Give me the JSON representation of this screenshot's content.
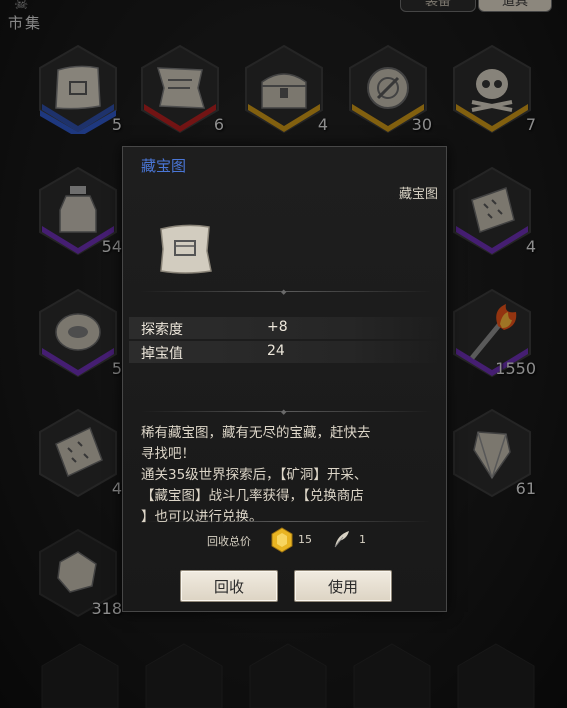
{
  "top": {
    "label": "市集",
    "tabs": [
      {
        "label": "装备",
        "active": false
      },
      {
        "label": "道具",
        "active": true
      }
    ]
  },
  "inventory": [
    {
      "name": "treasure-map",
      "count": "5",
      "rarity": "blue",
      "icon": "map-icon"
    },
    {
      "name": "scroll",
      "count": "6",
      "rarity": "red",
      "icon": "scroll-icon"
    },
    {
      "name": "treasure-chest",
      "count": "4",
      "rarity": "gold",
      "icon": "chest-icon"
    },
    {
      "name": "compass-emblem",
      "count": "30",
      "rarity": "gold",
      "icon": "emblem-icon"
    },
    {
      "name": "skull",
      "count": "7",
      "rarity": "gold",
      "icon": "skull-icon"
    },
    {
      "name": "potion-bottle",
      "count": "54",
      "rarity": "purple",
      "icon": "bottle-icon"
    },
    {
      "name": "rune-stone",
      "count": "4",
      "rarity": "purple",
      "icon": "rune-stone-icon"
    },
    {
      "name": "eye-amulet",
      "count": "5",
      "rarity": "purple",
      "icon": "eye-amulet-icon"
    },
    {
      "name": "torch",
      "count": "1550",
      "rarity": "purple",
      "icon": "torch-icon"
    },
    {
      "name": "rune-tablet",
      "count": "4",
      "rarity": "none",
      "icon": "rune-tablet-icon"
    },
    {
      "name": "crystal-shard",
      "count": "61",
      "rarity": "none",
      "icon": "crystal-icon"
    },
    {
      "name": "ore-chunk",
      "count": "318",
      "rarity": "none",
      "icon": "ore-icon"
    }
  ],
  "dialog": {
    "title": "藏宝图",
    "type": "藏宝图",
    "icon": "treasure-map-icon",
    "stats": [
      {
        "key": "探索度",
        "value": "+8"
      },
      {
        "key": "掉宝值",
        "value": "24"
      }
    ],
    "description_lines": [
      "稀有藏宝图，藏有无尽的宝藏，赶快去",
      "寻找吧！",
      "通关35级世界探索后，【矿洞】开采、",
      "【藏宝图】战斗几率获得，【兑换商店",
      "】也可以进行兑换。"
    ],
    "recycle_label": "回收总价",
    "gem_value": "15",
    "feather_value": "1",
    "buttons": {
      "recycle": "回收",
      "use": "使用"
    }
  },
  "colors": {
    "title_blue": "#4a76d6",
    "rarity_blue": "#2f56c4",
    "rarity_red": "#b02020",
    "rarity_gold": "#c89418",
    "rarity_purple": "#6a2fb0"
  }
}
